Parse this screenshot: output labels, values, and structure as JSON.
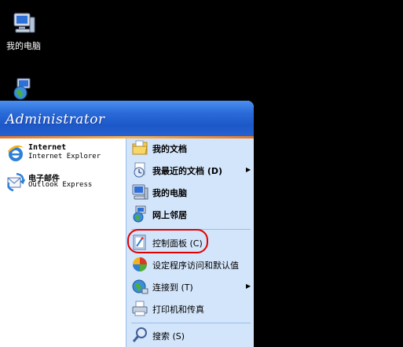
{
  "desktop": {
    "icons": [
      {
        "label": "我的电脑",
        "icon": "my-computer-icon"
      },
      {
        "label": "",
        "icon": "network-places-icon"
      }
    ]
  },
  "start_menu": {
    "user": "Administrator",
    "pinned": [
      {
        "title": "Internet",
        "subtitle": "Internet Explorer",
        "icon": "internet-explorer-icon"
      },
      {
        "title": "电子邮件",
        "subtitle": "Outlook Express",
        "icon": "outlook-express-icon"
      }
    ],
    "places": [
      {
        "label": "我的文档",
        "icon": "my-documents-icon"
      },
      {
        "label": "我最近的文档 (D)",
        "icon": "recent-documents-icon",
        "arrow": "▶"
      },
      {
        "label": "我的电脑",
        "icon": "my-computer-icon"
      },
      {
        "label": "网上邻居",
        "icon": "network-places-icon"
      },
      {
        "label": "控制面板 (C)",
        "icon": "control-panel-icon"
      },
      {
        "label": "设定程序访问和默认值",
        "icon": "program-access-icon"
      },
      {
        "label": "连接到 (T)",
        "icon": "connect-to-icon",
        "arrow": "▶"
      },
      {
        "label": "打印机和传真",
        "icon": "printers-icon"
      },
      {
        "label": "搜索 (S)",
        "icon": "search-icon"
      }
    ]
  },
  "colors": {
    "header_blue": "#2a6ad8",
    "right_pane": "#d3e5fa",
    "highlight_circle": "#e00000"
  }
}
